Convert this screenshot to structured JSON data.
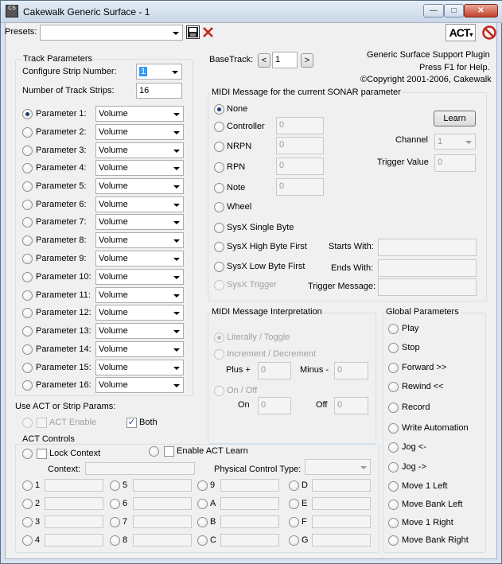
{
  "window": {
    "title": "Cakewalk Generic Surface - 1",
    "icon_text": "CS"
  },
  "toolbar": {
    "presets_label": "Presets:",
    "presets_value": "",
    "act_label": "ACT"
  },
  "track_params": {
    "title": "Track Parameters",
    "strip_label": "Configure Strip Number:",
    "strip_value": "1",
    "num_strips_label": "Number of Track Strips:",
    "num_strips_value": "16",
    "params": [
      {
        "label": "Parameter 1:",
        "value": "Volume"
      },
      {
        "label": "Parameter 2:",
        "value": "Volume"
      },
      {
        "label": "Parameter 3:",
        "value": "Volume"
      },
      {
        "label": "Parameter 4:",
        "value": "Volume"
      },
      {
        "label": "Parameter 5:",
        "value": "Volume"
      },
      {
        "label": "Parameter 6:",
        "value": "Volume"
      },
      {
        "label": "Parameter 7:",
        "value": "Volume"
      },
      {
        "label": "Parameter 8:",
        "value": "Volume"
      },
      {
        "label": "Parameter 9:",
        "value": "Volume"
      },
      {
        "label": "Parameter 10:",
        "value": "Volume"
      },
      {
        "label": "Parameter 11:",
        "value": "Volume"
      },
      {
        "label": "Parameter 12:",
        "value": "Volume"
      },
      {
        "label": "Parameter 13:",
        "value": "Volume"
      },
      {
        "label": "Parameter 14:",
        "value": "Volume"
      },
      {
        "label": "Parameter 15:",
        "value": "Volume"
      },
      {
        "label": "Parameter 16:",
        "value": "Volume"
      }
    ]
  },
  "use_act": {
    "title": "Use ACT or Strip Params:",
    "act_enable": "ACT Enable",
    "both": "Both"
  },
  "act_controls": {
    "title": "ACT Controls",
    "lock_context": "Lock Context",
    "enable_learn": "Enable ACT Learn",
    "context_label": "Context:",
    "context_value": "",
    "physical_label": "Physical Control Type:",
    "physical_value": "",
    "col1": [
      "1",
      "2",
      "3",
      "4"
    ],
    "col2": [
      "5",
      "6",
      "7",
      "8"
    ],
    "col3": [
      "9",
      "A",
      "B",
      "C"
    ],
    "col4": [
      "D",
      "E",
      "F",
      "G"
    ]
  },
  "basetrack": {
    "label": "BaseTrack:",
    "value": "1",
    "prev": "<",
    "next": ">"
  },
  "info": {
    "line1": "Generic Surface Support Plugin",
    "line2": "Press F1 for Help.",
    "line3": "©Copyright 2001-2006, Cakewalk"
  },
  "midi_msg": {
    "title": "MIDI Message for the current SONAR parameter",
    "none": "None",
    "controller": "Controller",
    "controller_value": "0",
    "nrpn": "NRPN",
    "nrpn_value": "0",
    "rpn": "RPN",
    "rpn_value": "0",
    "note": "Note",
    "note_value": "0",
    "wheel": "Wheel",
    "sysx_single": "SysX Single Byte",
    "sysx_high": "SysX High Byte First",
    "sysx_low": "SysX Low Byte First",
    "sysx_trigger": "SysX Trigger",
    "learn": "Learn",
    "channel_label": "Channel",
    "channel_value": "1",
    "trigger_value_label": "Trigger Value",
    "trigger_value": "0",
    "starts_label": "Starts With:",
    "ends_label": "Ends With:",
    "trigger_msg_label": "Trigger Message:",
    "starts_value": "",
    "ends_value": "",
    "trigger_msg_value": ""
  },
  "interp": {
    "title": "MIDI Message Interpretation",
    "literal": "Literally / Toggle",
    "incdec": "Increment / Decrement",
    "plus_label": "Plus +",
    "plus_value": "0",
    "minus_label": "Minus -",
    "minus_value": "0",
    "onoff": "On / Off",
    "on_label": "On",
    "on_value": "0",
    "off_label": "Off",
    "off_value": "0"
  },
  "global": {
    "title": "Global Parameters",
    "items": [
      "Play",
      "Stop",
      "Forward >>",
      "Rewind <<",
      "Record",
      "Write Automation",
      "Jog <-",
      "Jog ->",
      "Move 1 Left",
      "Move Bank Left",
      "Move 1 Right",
      "Move Bank Right"
    ]
  }
}
